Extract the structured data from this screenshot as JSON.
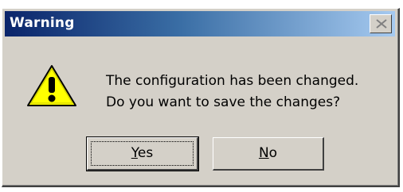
{
  "window": {
    "title": "Warning"
  },
  "icons": {
    "close": "close-icon",
    "warning": "warning-icon"
  },
  "message": {
    "line1": "The configuration has been changed.",
    "line2": "Do you want to save the changes?"
  },
  "buttons": {
    "yes_first": "Y",
    "yes_rest": "es",
    "no_first": "N",
    "no_rest": "o"
  },
  "colors": {
    "titlebar_start": "#0a246a",
    "titlebar_end": "#a6caf0",
    "dialog_bg": "#d4d0c8",
    "warning_fill": "#ffff00"
  }
}
